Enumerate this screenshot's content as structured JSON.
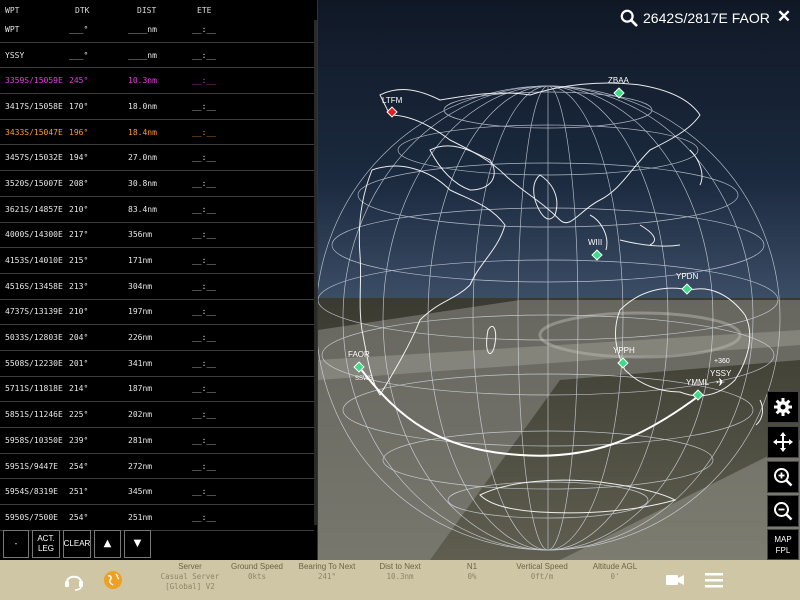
{
  "flight_plan": {
    "headers": {
      "wpt": "WPT",
      "dtk": "DTK",
      "dist": "DIST",
      "ete": "ETE"
    },
    "rows": [
      {
        "wpt": "WPT",
        "dtk": "___°",
        "dist": "____nm",
        "ete": "__:__",
        "state": "normal"
      },
      {
        "wpt": "YSSY",
        "dtk": "___°",
        "dist": "____nm",
        "ete": "__:__",
        "state": "normal"
      },
      {
        "wpt": "3359S/15059E",
        "dtk": "245°",
        "dist": "10.3nm",
        "ete": "__:__",
        "state": "active"
      },
      {
        "wpt": "3417S/15058E",
        "dtk": "170°",
        "dist": "18.0nm",
        "ete": "__:__",
        "state": "normal"
      },
      {
        "wpt": "3433S/15047E",
        "dtk": "196°",
        "dist": "18.4nm",
        "ete": "__:__",
        "state": "next"
      },
      {
        "wpt": "3457S/15032E",
        "dtk": "194°",
        "dist": "27.0nm",
        "ete": "__:__",
        "state": "normal"
      },
      {
        "wpt": "3520S/15007E",
        "dtk": "208°",
        "dist": "30.8nm",
        "ete": "__:__",
        "state": "normal"
      },
      {
        "wpt": "3621S/14857E",
        "dtk": "210°",
        "dist": "83.4nm",
        "ete": "__:__",
        "state": "normal"
      },
      {
        "wpt": "4000S/14300E",
        "dtk": "217°",
        "dist": "356nm",
        "ete": "__:__",
        "state": "normal"
      },
      {
        "wpt": "4153S/14010E",
        "dtk": "215°",
        "dist": "171nm",
        "ete": "__:__",
        "state": "normal"
      },
      {
        "wpt": "4516S/13458E",
        "dtk": "213°",
        "dist": "304nm",
        "ete": "__:__",
        "state": "normal"
      },
      {
        "wpt": "4737S/13139E",
        "dtk": "210°",
        "dist": "197nm",
        "ete": "__:__",
        "state": "normal"
      },
      {
        "wpt": "5033S/12803E",
        "dtk": "204°",
        "dist": "226nm",
        "ete": "__:__",
        "state": "normal"
      },
      {
        "wpt": "5508S/12230E",
        "dtk": "201°",
        "dist": "341nm",
        "ete": "__:__",
        "state": "normal"
      },
      {
        "wpt": "5711S/11818E",
        "dtk": "214°",
        "dist": "187nm",
        "ete": "__:__",
        "state": "normal"
      },
      {
        "wpt": "5851S/11246E",
        "dtk": "225°",
        "dist": "202nm",
        "ete": "__:__",
        "state": "normal"
      },
      {
        "wpt": "5958S/10350E",
        "dtk": "239°",
        "dist": "281nm",
        "ete": "__:__",
        "state": "normal"
      },
      {
        "wpt": "5951S/9447E",
        "dtk": "254°",
        "dist": "272nm",
        "ete": "__:__",
        "state": "normal"
      },
      {
        "wpt": "5954S/8319E",
        "dtk": "251°",
        "dist": "345nm",
        "ete": "__:__",
        "state": "normal"
      },
      {
        "wpt": "5950S/7500E",
        "dtk": "254°",
        "dist": "251nm",
        "ete": "__:__",
        "state": "normal"
      }
    ],
    "buttons": {
      "remove": "-",
      "activate_leg": "ACT.\nLEG",
      "clear": "CLEAR",
      "move_up": "▲",
      "move_down": "▼"
    }
  },
  "search": {
    "text": "2642S/2817E FAOR",
    "icon": "search-icon"
  },
  "close_icon": "close-icon",
  "map": {
    "airports": [
      {
        "code": "LTFM",
        "color": "#e02020"
      },
      {
        "code": "ZBAA",
        "color": "#3ddc84"
      },
      {
        "code": "WIII",
        "color": "#3ddc84"
      },
      {
        "code": "YPDN",
        "color": "#3ddc84"
      },
      {
        "code": "FAOR",
        "color": "#3ddc84"
      },
      {
        "code": "YPPH",
        "color": "#3ddc84"
      },
      {
        "code": "YMML",
        "color": "#3ddc84"
      },
      {
        "code": "YSSY",
        "color": "#3ddc84"
      }
    ],
    "aircraft_label": "+360",
    "faor_sublabel": "SSWS",
    "route_color": "#ffffff"
  },
  "tools": [
    "gear-icon",
    "recenter-icon",
    "zoom-in-icon",
    "zoom-out-icon"
  ],
  "map_fpl_label": "MAP\nFPL",
  "status_bar": {
    "items": [
      {
        "label": "Server",
        "value": "Casual Server\n[Global] V2"
      },
      {
        "label": "Ground Speed",
        "value": "0kts"
      },
      {
        "label": "Bearing To Next",
        "value": "241°"
      },
      {
        "label": "Dist to Next",
        "value": "10.3nm"
      },
      {
        "label": "N1",
        "value": "0%"
      },
      {
        "label": "Vertical Speed",
        "value": "0ft/m"
      },
      {
        "label": "Altitude AGL",
        "value": "0'"
      }
    ],
    "icons": [
      "headset-icon",
      "globe-icon",
      "camera-icon",
      "menu-icon"
    ]
  }
}
